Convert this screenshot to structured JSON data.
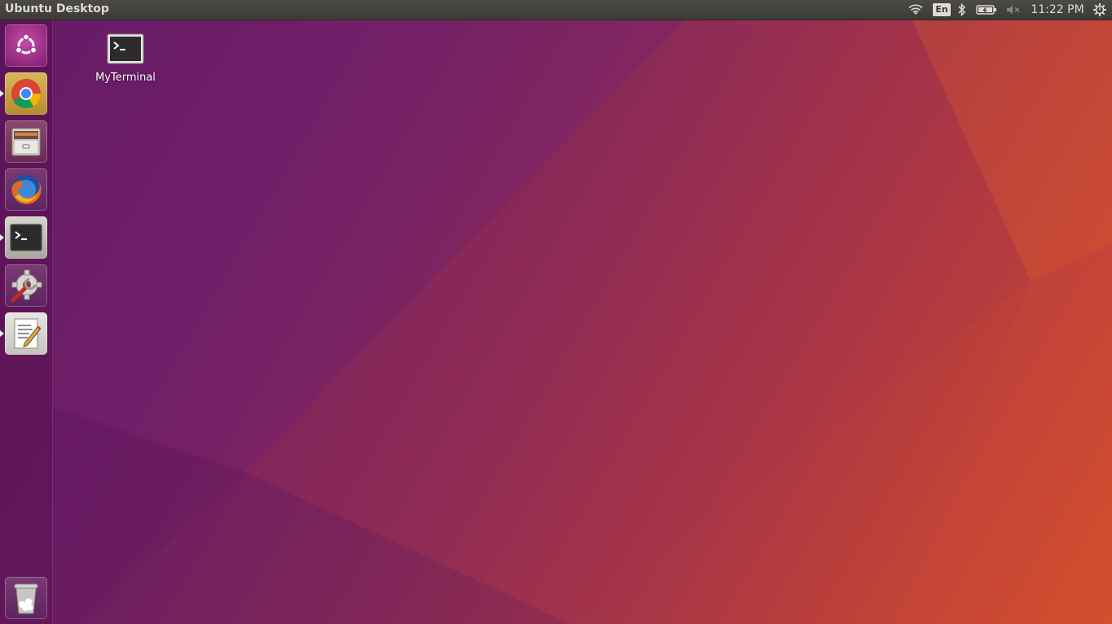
{
  "panel": {
    "title": "Ubuntu Desktop",
    "language": "En",
    "clock": "11:22 PM"
  },
  "launcher": {
    "items": [
      {
        "name": "dash-home",
        "icon": "ubuntu-logo-icon",
        "running": false
      },
      {
        "name": "chrome",
        "icon": "chrome-icon",
        "running": true
      },
      {
        "name": "files",
        "icon": "file-cabinet-icon",
        "running": false
      },
      {
        "name": "firefox",
        "icon": "firefox-icon",
        "running": false
      },
      {
        "name": "terminal",
        "icon": "terminal-icon",
        "running": true
      },
      {
        "name": "system-settings",
        "icon": "settings-gear-wrench-icon",
        "running": false
      },
      {
        "name": "text-editor",
        "icon": "text-editor-icon",
        "running": true
      },
      {
        "name": "trash",
        "icon": "trash-icon",
        "running": false
      }
    ]
  },
  "desktop": {
    "icons": [
      {
        "label": "MyTerminal",
        "icon": "terminal-icon"
      }
    ]
  },
  "colors": {
    "panel_bg": "#3c3b37",
    "panel_text": "#dfdbd2",
    "wallpaper_left": "#5e1a63",
    "wallpaper_right": "#d4512a",
    "ubuntu_accent": "#dd4814"
  }
}
